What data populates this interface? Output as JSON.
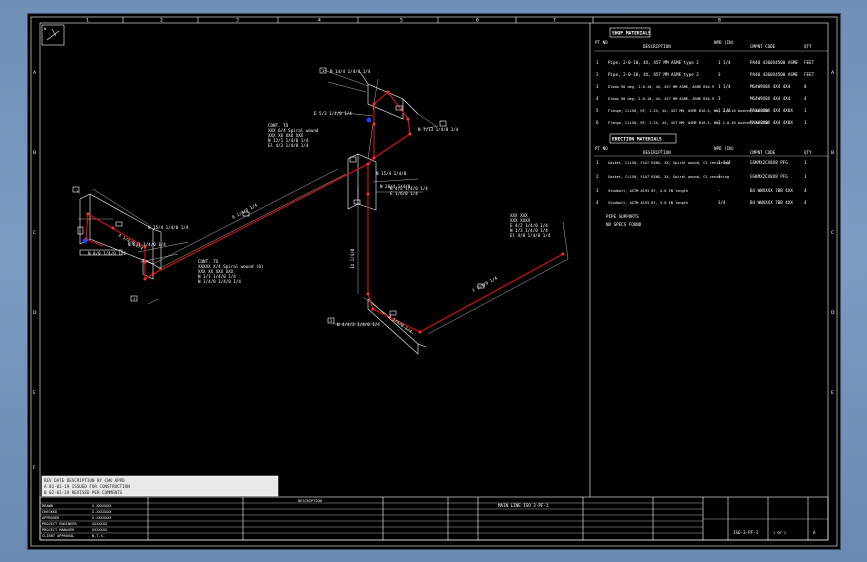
{
  "colors": {
    "background": "#000000",
    "pipe": "#e01010",
    "line": "#ffffff",
    "valve": "#2040ff",
    "frame": "#7e9cc2"
  },
  "zones_top": [
    "1",
    "2",
    "3",
    "4",
    "5",
    "6",
    "7",
    "8"
  ],
  "zones_side": [
    "A",
    "B",
    "C",
    "D",
    "E",
    "F"
  ],
  "corner_icon": "pipe-isometric-icon",
  "shop_materials": {
    "title": "SHOP MATERIALS",
    "cols": {
      "pt": "PT NO",
      "desc": "DESCRIPTION",
      "npd": "NPD (IN)",
      "code": "CMPNT CODE",
      "qty": "QTY"
    },
    "rows": [
      {
        "pt": "1",
        "desc": "Pipe, 2-0-10, 4X, 457 MM ASME type 2",
        "npd": "1 1/4",
        "code": "PA40 4360X4500 ASME",
        "qty": "FEET"
      },
      {
        "pt": "2",
        "desc": "Pipe, 2-0-10, 4X, 457 MM ASME type 2",
        "npd": "3",
        "code": "PA40 4360X4500 ASME",
        "qty": "FEET"
      },
      {
        "pt": "3",
        "desc": "Elbow 90 deg, 2-0-10, 4X, 457 MM ASME, ASME B16.9",
        "npd": "1 1/4",
        "code": "MG4W9X8X 4X4 4X4",
        "qty": "8"
      },
      {
        "pt": "4",
        "desc": "Elbow 90 deg, 2-0-10, 4X, 457 MM ASME, ASME B16.9",
        "npd": "3",
        "code": "MG4W9X8X 4X4 4X4",
        "qty": "4"
      },
      {
        "pt": "5",
        "desc": "Flange, CL150, RF, 1-2X, 4X, 457 MM, ASME B16.5, WN, 2-0-10 bushed, 40 SCH",
        "npd": "1 1/4",
        "code": "MAX40X8X 4X4 4X8X",
        "qty": "1"
      },
      {
        "pt": "6",
        "desc": "Flange, CL150, RF, 1-2X, 4X, 457 MM, ASME B16.5, WN, 2-0-10 bushed, 40 SCH",
        "npd": "3",
        "code": "MAX40X8X 4X4 4X8X",
        "qty": "1"
      }
    ]
  },
  "field_materials": {
    "title": "ERECTION MATERIALS",
    "cols": {
      "pt": "PT NO",
      "desc": "DESCRIPTION",
      "npd": "NPD (IN)",
      "code": "CMPNT CODE",
      "qty": "QTY"
    },
    "rows": [
      {
        "pt": "1",
        "desc": "Gasket, CL150, FLAT RING, 3X, Spiral wound, CS centering",
        "npd": "1 1/4",
        "code": "GSKMX2CX8X8 PFG",
        "qty": "1"
      },
      {
        "pt": "2",
        "desc": "Gasket, CL150, FLAT RING, 3X, Spiral wound, CS centering",
        "npd": "3",
        "code": "GSKMX2CX8X8 PFG",
        "qty": "1"
      },
      {
        "pt": "3",
        "desc": "Studbolt, ASTM A193 B7, 4.0 IN length",
        "npd": "-",
        "code": "B4 WWXXXX 7BB 4XX",
        "qty": "4"
      },
      {
        "pt": "4",
        "desc": "Studbolt, ASTM A193 B7, 4.0 IN length",
        "npd": "3/4",
        "code": "B4 WWXXXX 7BB 4XX",
        "qty": "4"
      }
    ],
    "notes_title": "PIPE SUPPORTS",
    "notes_text": "NO SPECS FOUND"
  },
  "annotations": {
    "a1": {
      "tag": "1",
      "text": "N 14/4 1/4/0 1/4"
    },
    "a2": {
      "line1": "E 5/3 1/4/0 1/4",
      "line2": "N 7/13 1/4/0 1/4"
    },
    "a3": {
      "title": "CONT. TO",
      "line1": "XXX 6/4 Spiral wound",
      "line2": "XXX XX XXX XXX",
      "line3": "N 12/1 1/4/0 1/4",
      "line4": "El 4/2 1/4/0 1/4"
    },
    "a4": {
      "line1": "N 15/4 1/4/0",
      "line2": "N 20/4 1/4/0"
    },
    "a5": {
      "line1": "N 4/2 1/4/0 1/4",
      "line2": "E 1/6/0 1/4"
    },
    "a6": {
      "line1": "N 15/4 1/4/0 1/4",
      "line2": "N 8/1 1/4/0 1/4"
    },
    "a7": {
      "title": "CONT. TO",
      "line1": "XXXXX X/4 Spiral wound (6)",
      "line2": "XXX XX XXX XXX",
      "line3": "N 1/1 1/4/0 1/4",
      "line4": "N 1/4/0 1/4/0 1/4"
    },
    "a8": {
      "tag": "1",
      "text": "N 0/0 1/4/0 1/4"
    },
    "a9": {
      "title": "XXX XXX",
      "line1": "XXX XXXX",
      "line2": "E 4/2 1/4/0 1/4",
      "line3": "N 1/3 1/4/0 1/4",
      "line4": "El 4/0 1/4/0 1/4"
    },
    "a10": {
      "tag": "2",
      "text": "N 4/4/2 1/4/0 1/4"
    },
    "dim1": "4 1/4/0 1/4",
    "dim2": "9 1/4/0 1/4",
    "dim3": "14 1/4/0",
    "dim4": "1 1/4/0 1/4",
    "dim5": "3 1/4/0 1/4"
  },
  "revisions": {
    "header": "REV  DATE  DESCRIPTION  BY  CHK  APPD",
    "rows": [
      "A  01-01-19  ISSUED FOR CONSTRUCTION",
      "B  02-01-19  REVISED PER COMMENTS"
    ]
  },
  "title_block": {
    "left_labels": [
      "DRAWN",
      "CHECKED",
      "APPROVED",
      "PROJECT ENGINEER",
      "PROJECT MANAGER",
      "CLIENT APPROVAL",
      "SCALE"
    ],
    "left_values": [
      "X.XXXXXXX",
      "X.XXXXXXX",
      "X.XXXXXXX",
      "XXXXXXX",
      "XXXXXXX",
      "XXXXXXX",
      "N.T.S."
    ],
    "description": "DESCRIPTION",
    "line_id": "MAIN LINE ISO 3-PF-1",
    "drawing_no": "ISO-3-PF-1",
    "sheet": "1 OF 1",
    "rev": "A"
  }
}
